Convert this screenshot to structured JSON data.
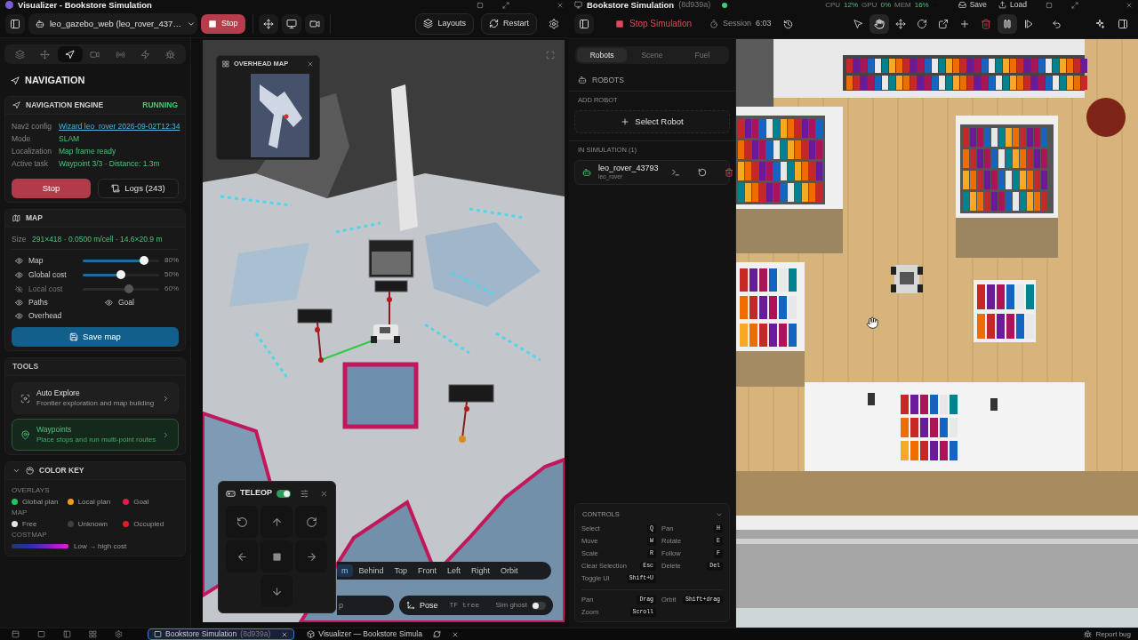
{
  "visualizer": {
    "title": "Visualizer - Bookstore Simulation",
    "source": "leo_gazebo_web (leo_rover_437…",
    "stop": "Stop",
    "layouts": "Layouts",
    "restart": "Restart",
    "panel_tabs": [
      {
        "kind": "layers",
        "selected": false
      },
      {
        "kind": "move",
        "selected": false
      },
      {
        "kind": "navigation",
        "selected": true
      },
      {
        "kind": "video",
        "selected": false
      },
      {
        "kind": "radio",
        "selected": false
      },
      {
        "kind": "zap",
        "selected": false
      },
      {
        "kind": "bug",
        "selected": false
      }
    ],
    "navigation": {
      "title": "NAVIGATION",
      "engine": "NAVIGATION ENGINE",
      "status": "RUNNING",
      "rows": [
        {
          "kind": "link",
          "label": "Nav2 config",
          "value": "Wizard leo_rover 2026-09-02T12:34"
        },
        {
          "kind": "text",
          "label": "Mode",
          "value": "SLAM"
        },
        {
          "kind": "text",
          "label": "Localization",
          "value": "Map frame ready"
        },
        {
          "kind": "text",
          "label": "Active task",
          "value": "Waypoint 3/3 · Distance: 1.3m"
        }
      ],
      "stop": "Stop",
      "logs": "Logs (243)"
    },
    "map": {
      "title": "MAP",
      "size_label": "Size",
      "size": "291×418 · 0.0500 m/cell · 14.6×20.9 m",
      "layers": [
        {
          "label": "Map",
          "visible": true,
          "level": 0.8,
          "reading": "80%"
        },
        {
          "label": "Global cost",
          "visible": true,
          "level": 0.5,
          "reading": "50%"
        },
        {
          "label": "Local cost",
          "visible": false,
          "level": 0.6,
          "reading": "60%"
        }
      ],
      "toggles": [
        {
          "label": "Paths",
          "visible": true
        },
        {
          "label": "Goal",
          "visible": true
        },
        {
          "label": "Overhead",
          "visible": true
        }
      ],
      "save": "Save map"
    },
    "tools": {
      "title": "TOOLS",
      "items": [
        {
          "kind": "explore",
          "title": "Auto Explore",
          "subtitle": "Frontier exploration and map building",
          "selected": false
        },
        {
          "kind": "waypoints",
          "title": "Waypoints",
          "subtitle": "Place stops and run multi-point routes",
          "selected": true
        }
      ]
    },
    "color_key": {
      "title": "COLOR KEY",
      "expanded": true,
      "groups": [
        {
          "title": "OVERLAYS",
          "items": [
            {
              "label": "Global plan",
              "color": "#22c55e"
            },
            {
              "label": "Local plan",
              "color": "#f59e0b"
            },
            {
              "label": "Goal",
              "color": "#e11d48"
            }
          ]
        },
        {
          "title": "MAP",
          "items": [
            {
              "label": "Free",
              "color": "#e5e5e5"
            },
            {
              "label": "Unknown",
              "color": "#3f3f3f"
            },
            {
              "label": "Occupied",
              "color": "#dc1f26"
            }
          ]
        }
      ],
      "costmap_title": "COSTMAP",
      "costmap_label": "Low → high cost"
    },
    "viewport": {
      "overhead_title": "OVERHEAD MAP",
      "teleop": {
        "title": "TELEOP",
        "on": true
      },
      "views": [
        {
          "label": "m",
          "selected": true
        },
        {
          "label": "Behind",
          "selected": false
        },
        {
          "label": "Top",
          "selected": false
        },
        {
          "label": "Front",
          "selected": false
        },
        {
          "label": "Left",
          "selected": false
        },
        {
          "label": "Right",
          "selected": false
        },
        {
          "label": "Orbit",
          "selected": false
        }
      ],
      "search": {
        "placeholder": "p"
      },
      "pose": "Pose",
      "tf_tree": "TF tree",
      "ghost": {
        "label": "Sim ghost",
        "on": false
      }
    }
  },
  "simulation": {
    "title": "Bookstore Simulation",
    "id": "(8d939a)",
    "online": true,
    "stats": [
      {
        "label": "CPU",
        "value": "12%"
      },
      {
        "label": "GPU",
        "value": "0%"
      },
      {
        "label": "MEM",
        "value": "16%"
      }
    ],
    "save": "Save",
    "load": "Load",
    "stop": "Stop Simulation",
    "session_label": "Session",
    "session_time": "6:03",
    "tools": [
      {
        "kind": "pointer",
        "selected": false
      },
      {
        "kind": "hand",
        "selected": true
      },
      {
        "kind": "move",
        "selected": false
      },
      {
        "kind": "rotate",
        "selected": false
      },
      {
        "kind": "scale",
        "selected": false
      },
      {
        "kind": "add",
        "selected": false
      },
      {
        "kind": "delete",
        "selected": false
      },
      {
        "kind": "pause",
        "selected": true
      },
      {
        "kind": "step",
        "selected": false
      }
    ],
    "tabs": [
      {
        "label": "Robots",
        "selected": true
      },
      {
        "label": "Scene",
        "selected": false
      },
      {
        "label": "Fuel",
        "selected": false
      }
    ],
    "section": "ROBOTS",
    "add_title": "ADD ROBOT",
    "select_robot": "Select Robot",
    "in_sim": "IN SIMULATION (1)",
    "robots": [
      {
        "name": "leo_rover_43793",
        "model": "leo_rover"
      }
    ],
    "controls": {
      "title": "CONTROLS",
      "expanded": true,
      "keys": [
        {
          "label": "Select",
          "key": "Q"
        },
        {
          "label": "Pan",
          "key": "H"
        },
        {
          "label": "Move",
          "key": "W"
        },
        {
          "label": "Rotate",
          "key": "E"
        },
        {
          "label": "Scale",
          "key": "R"
        },
        {
          "label": "Follow",
          "key": "F"
        },
        {
          "label": "Clear Selection",
          "key": "Esc"
        },
        {
          "label": "Delete",
          "key": "Del"
        },
        {
          "label": "Toggle UI",
          "key": "Shift+U"
        }
      ],
      "mouse": [
        {
          "label": "Pan",
          "key": "Drag"
        },
        {
          "label": "Orbit",
          "key": "Shift+drag"
        },
        {
          "label": "Zoom",
          "key": "Scroll"
        }
      ]
    }
  },
  "taskbar": {
    "tabs": [
      {
        "kind": "simulation",
        "title": "Bookstore Simulation",
        "id": "(8d939a)",
        "selected": true
      },
      {
        "kind": "visualizer",
        "title": "Visualizer — Bookstore Simula",
        "selected": false
      }
    ],
    "report": "Report bug"
  }
}
